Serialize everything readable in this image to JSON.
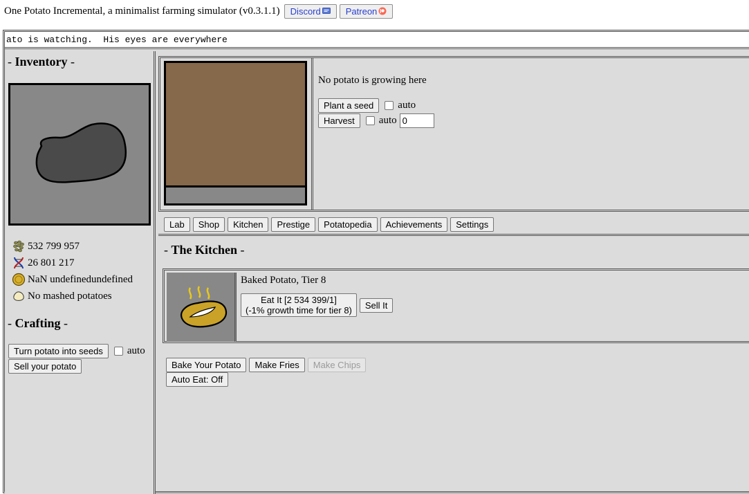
{
  "header": {
    "title": "One Potato Incremental, a minimalist farming simulator (v0.3.1.1)",
    "discord_label": "Discord",
    "patreon_label": "Patreon"
  },
  "ticker": {
    "text": "ato is watching.  His eyes are everywhere"
  },
  "inventory": {
    "title": "Inventory",
    "seeds": "532 799 957",
    "dna": "26 801 217",
    "coins": "NaN undefinedundefined",
    "mashed": "No mashed potatoes"
  },
  "crafting": {
    "title": "Crafting",
    "seeds_button": "Turn potato into seeds",
    "auto_label": "auto",
    "sell_button": "Sell your potato"
  },
  "plot": {
    "status": "No potato is growing here",
    "plant_button": "Plant a seed",
    "plant_auto_label": "auto",
    "harvest_button": "Harvest",
    "harvest_auto_label": "auto",
    "harvest_value": "0"
  },
  "tabs": [
    "Lab",
    "Shop",
    "Kitchen",
    "Prestige",
    "Potatopedia",
    "Achievements",
    "Settings"
  ],
  "kitchen": {
    "title": "The Kitchen",
    "item_name": "Baked Potato, Tier 8",
    "eat_line1": "Eat It [2 534 399/1]",
    "eat_line2": "(-1% growth time for tier 8)",
    "sell_button": "Sell It",
    "bake_button": "Bake Your Potato",
    "fries_button": "Make Fries",
    "chips_button": "Make Chips",
    "auto_eat_button": "Auto Eat: Off"
  },
  "colors": {
    "panel_bg": "#dcdcdc",
    "field_dirt": "#86684a",
    "potato_dark": "#4a4a4a",
    "baked_potato": "#c9a227",
    "link_text": "#2a3fcf"
  }
}
